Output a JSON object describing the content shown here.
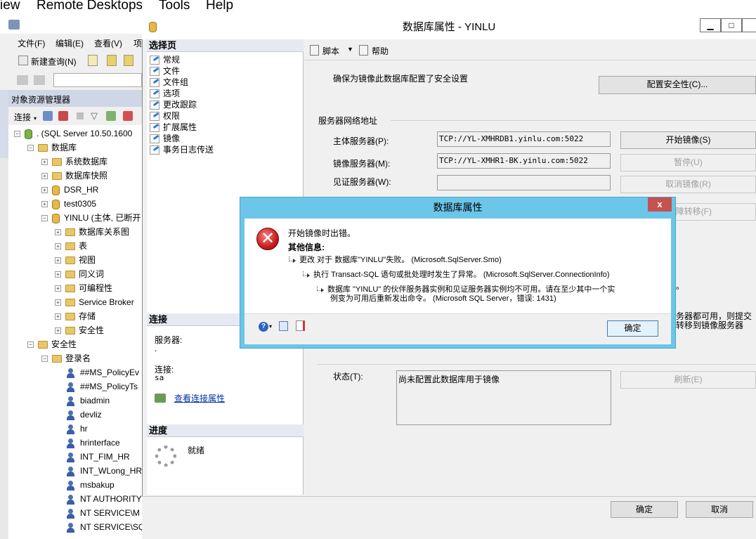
{
  "rd_menu": {
    "view": "iew",
    "remote": "Remote Desktops",
    "tools": "Tools",
    "help": "Help"
  },
  "ssms_menu": {
    "file": "文件(F)",
    "edit": "编辑(E)",
    "view": "查看(V)",
    "more": "项"
  },
  "ssms_toolbar": {
    "new_query": "新建查询(N)"
  },
  "object_explorer": {
    "title": "对象资源管理器",
    "connect": "连接",
    "server": ". (SQL Server 10.50.1600",
    "databases": "数据库",
    "nodes": {
      "sysdb": "系统数据库",
      "snapshots": "数据库快照",
      "dsr": "DSR_HR",
      "test": "test0305",
      "yinlu": "YINLU (主体, 已断开",
      "diagrams": "数据库关系图",
      "tables": "表",
      "views": "视图",
      "synonyms": "同义词",
      "programmability": "可编程性",
      "broker": "Service Broker",
      "storage": "存储",
      "dbsecurity": "安全性",
      "security": "安全性",
      "logins": "登录名"
    },
    "logins": [
      "##MS_PolicyEv",
      "##MS_PolicyTs",
      "biadmin",
      "devliz",
      "hr",
      "hrinterface",
      "INT_FIM_HR",
      "INT_WLong_HR",
      "msbakup",
      "NT AUTHORITY",
      "NT SERVICE\\M",
      "NT SERVICE\\SQ"
    ]
  },
  "dialog": {
    "title": "数据库属性 - YINLU",
    "select_page": "选择页",
    "pages": [
      "常规",
      "文件",
      "文件组",
      "选项",
      "更改跟踪",
      "权限",
      "扩展属性",
      "镜像",
      "事务日志传送"
    ],
    "script": "脚本",
    "help": "帮助",
    "security_note": "确保为镜像此数据库配置了安全设置",
    "configure_security": "配置安全性(C)...",
    "network_section": "服务器网络地址",
    "principal_label": "主体服务器(P):",
    "principal_value": "TCP://YL-XMHRDB1.yinlu.com:5022",
    "mirror_label": "镜像服务器(M):",
    "mirror_value": "TCP://YL-XMHR1-BK.yinlu.com:5022",
    "witness_label": "见证服务器(W):",
    "witness_value": "",
    "start_mirroring": "开始镜像(S)",
    "pause": "暂停(U)",
    "remove_mirroring": "取消镜像(R)",
    "failover": "故障转移(F)",
    "bg_note_1": "。",
    "bg_note_2": "务器都可用，则提交",
    "bg_note_3": "转移到镜像服务器",
    "status_label": "状态(T):",
    "status_value": "尚未配置此数据库用于镜像",
    "refresh": "刷新(E)",
    "connection_header": "连接",
    "server_label": "服务器:",
    "server_value": ".",
    "conn_label": "连接:",
    "conn_value": "sa",
    "view_conn_props": "查看连接属性",
    "progress_header": "进度",
    "progress_status": "就绪",
    "ok": "确定",
    "cancel": "取消"
  },
  "error": {
    "title": "数据库属性",
    "close": "x",
    "message": "开始镜像时出错。",
    "other_info": "其他信息:",
    "line1": "更改 对于 数据库\"YINLU\"失败。  (Microsoft.SqlServer.Smo)",
    "line2": "执行 Transact-SQL 语句或批处理时发生了异常。 (Microsoft.SqlServer.ConnectionInfo)",
    "line3a": "数据库 \"YINLU\" 的伙伴服务器实例和见证服务器实例均不可用。请在至少其中一个实",
    "line3b": "例变为可用后重新发出命令。 (Microsoft SQL Server，错误: 1431)",
    "ok": "确定"
  }
}
